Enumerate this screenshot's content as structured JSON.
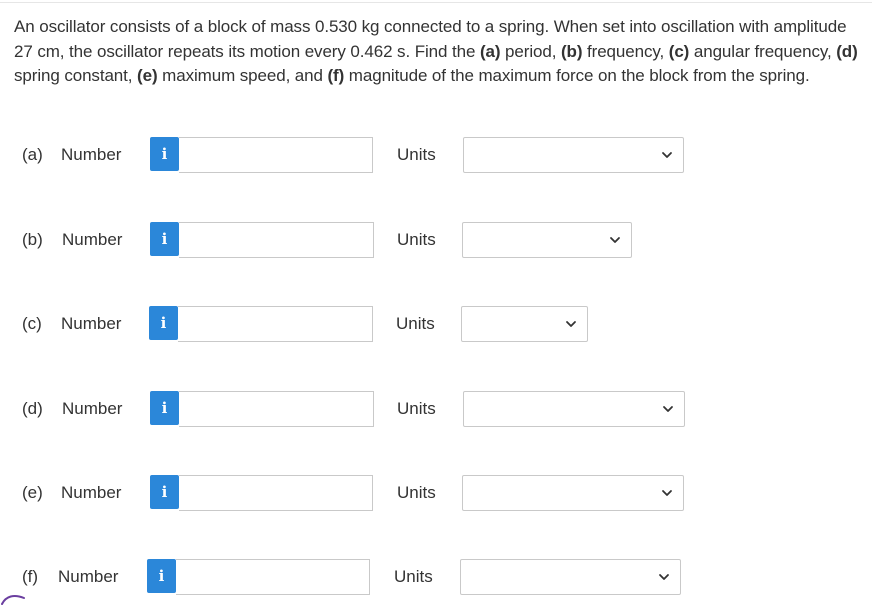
{
  "question": {
    "text_parts": [
      {
        "t": "An oscillator consists of a block of mass 0.530 kg connected to a spring. When set into oscillation with amplitude 27 cm, the oscillator repeats its motion every 0.462 s. Find the ",
        "b": false
      },
      {
        "t": "(a)",
        "b": true
      },
      {
        "t": " period, ",
        "b": false
      },
      {
        "t": "(b)",
        "b": true
      },
      {
        "t": " frequency, ",
        "b": false
      },
      {
        "t": "(c)",
        "b": true
      },
      {
        "t": " angular frequency, ",
        "b": false
      },
      {
        "t": "(d)",
        "b": true
      },
      {
        "t": " spring constant, ",
        "b": false
      },
      {
        "t": "(e)",
        "b": true
      },
      {
        "t": " maximum speed, and ",
        "b": false
      },
      {
        "t": "(f)",
        "b": true
      },
      {
        "t": " magnitude of the maximum force on the block from the spring.",
        "b": false
      }
    ]
  },
  "parts": [
    {
      "id": "a",
      "letter": "(a)",
      "number_label": "Number",
      "info_icon": "info-icon",
      "info_glyph": "i",
      "value": "",
      "units_label": "Units",
      "units_selected": "",
      "chevron_icon": "chevron-down-icon"
    },
    {
      "id": "b",
      "letter": "(b)",
      "number_label": "Number",
      "info_icon": "info-icon",
      "info_glyph": "i",
      "value": "",
      "units_label": "Units",
      "units_selected": "",
      "chevron_icon": "chevron-down-icon"
    },
    {
      "id": "c",
      "letter": "(c)",
      "number_label": "Number",
      "info_icon": "info-icon",
      "info_glyph": "i",
      "value": "",
      "units_label": "Units",
      "units_selected": "",
      "chevron_icon": "chevron-down-icon"
    },
    {
      "id": "d",
      "letter": "(d)",
      "number_label": "Number",
      "info_icon": "info-icon",
      "info_glyph": "i",
      "value": "",
      "units_label": "Units",
      "units_selected": "",
      "chevron_icon": "chevron-down-icon"
    },
    {
      "id": "e",
      "letter": "(e)",
      "number_label": "Number",
      "info_icon": "info-icon",
      "info_glyph": "i",
      "value": "",
      "units_label": "Units",
      "units_selected": "",
      "chevron_icon": "chevron-down-icon"
    },
    {
      "id": "f",
      "letter": "(f)",
      "number_label": "Number",
      "info_icon": "info-icon",
      "info_glyph": "i",
      "value": "",
      "units_label": "Units",
      "units_selected": "",
      "chevron_icon": "chevron-down-icon"
    }
  ],
  "colors": {
    "info_icon_bg": "#2b87d9",
    "text": "#333333",
    "input_border": "#c9c9c9",
    "corner_mark": "#6b3fa0"
  }
}
